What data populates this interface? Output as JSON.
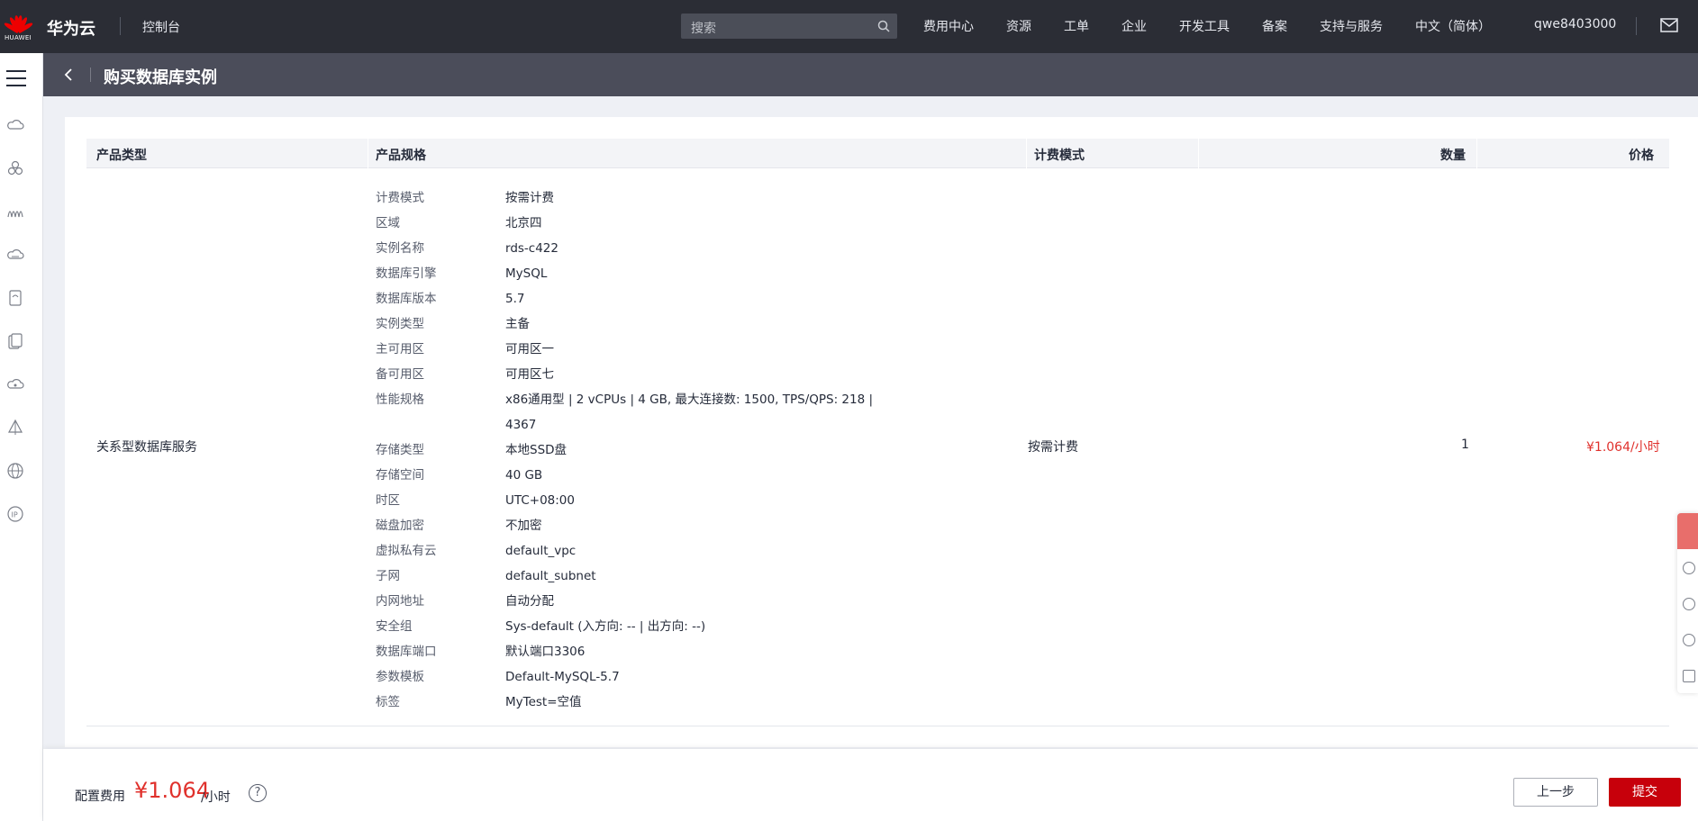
{
  "topbar": {
    "logo_word": "HUAWEI",
    "brand": "华为云",
    "console": "控制台",
    "search_placeholder": "搜索",
    "nav": [
      "费用中心",
      "资源",
      "工单",
      "企业",
      "开发工具",
      "备案",
      "支持与服务",
      "中文（简体）"
    ],
    "user": "qwe8403000"
  },
  "subbar": {
    "title": "购买数据库实例"
  },
  "table": {
    "headers": {
      "type": "产品类型",
      "spec": "产品规格",
      "billing": "计费模式",
      "qty": "数量",
      "price": "价格"
    },
    "row": {
      "type": "关系型数据库服务",
      "billing": "按需计费",
      "qty": "1",
      "price": "¥1.064/小时",
      "specs": [
        {
          "k": "计费模式",
          "v": "按需计费"
        },
        {
          "k": "区域",
          "v": "北京四"
        },
        {
          "k": "实例名称",
          "v": "rds-c422"
        },
        {
          "k": "数据库引擎",
          "v": "MySQL"
        },
        {
          "k": "数据库版本",
          "v": "5.7"
        },
        {
          "k": "实例类型",
          "v": "主备"
        },
        {
          "k": "主可用区",
          "v": "可用区一"
        },
        {
          "k": "备可用区",
          "v": "可用区七"
        },
        {
          "k": "性能规格",
          "v": "x86通用型 | 2 vCPUs | 4 GB, 最大连接数: 1500, TPS/QPS: 218 | 4367"
        },
        {
          "k": "存储类型",
          "v": "本地SSD盘"
        },
        {
          "k": "存储空间",
          "v": "40 GB"
        },
        {
          "k": "时区",
          "v": "UTC+08:00"
        },
        {
          "k": "磁盘加密",
          "v": "不加密"
        },
        {
          "k": "虚拟私有云",
          "v": "default_vpc"
        },
        {
          "k": "子网",
          "v": "default_subnet"
        },
        {
          "k": "内网地址",
          "v": "自动分配"
        },
        {
          "k": "安全组",
          "v": "Sys-default (入方向: -- | 出方向: --)"
        },
        {
          "k": "数据库端口",
          "v": "默认端口3306"
        },
        {
          "k": "参数模板",
          "v": "Default-MySQL-5.7"
        },
        {
          "k": "标签",
          "v": "MyTest=空值"
        }
      ]
    }
  },
  "footer": {
    "fee_label": "配置费用",
    "fee_amount": "¥1.064",
    "fee_unit": "/小时",
    "help": "?",
    "prev": "上一步",
    "submit": "提交"
  },
  "colors": {
    "accent_red": "#c7000b",
    "price_red": "#e0312c",
    "topbar": "#2b2d35",
    "subbar": "#4b4d5a"
  }
}
